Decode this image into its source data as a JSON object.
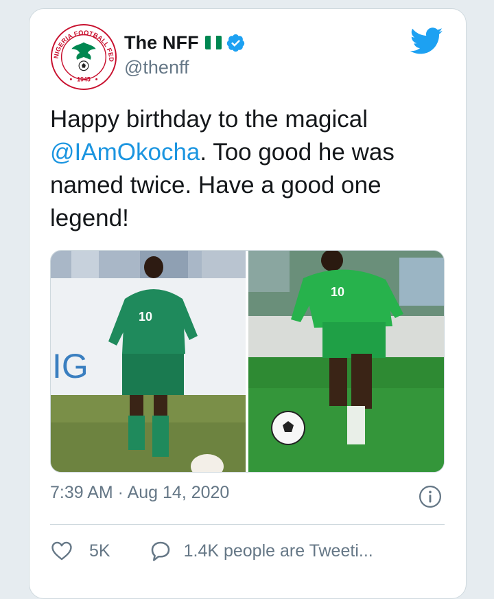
{
  "author": {
    "name": "The NFF",
    "handle": "@thenff",
    "avatar_text_top": "NIGERIA FOOTBALL FEDERATION",
    "avatar_year": "1945"
  },
  "tweet": {
    "text_before": "Happy birthday to the magical ",
    "mention": "@IAmOkocha",
    "text_after": ". Too good he was named twice. Have a good one legend!"
  },
  "media": {
    "left_jersey_number": "10",
    "left_board_text": "IG",
    "right_jersey_number": "10"
  },
  "meta": {
    "time": "7:39 AM",
    "separator": " · ",
    "date": "Aug 14, 2020"
  },
  "engagement": {
    "likes": "5K",
    "tweeting": "1.4K people are Tweeti..."
  },
  "colors": {
    "accent": "#1b95e0",
    "twitter_blue": "#1da1f2",
    "nigeria_green": "#008751",
    "muted": "#657786"
  },
  "icons": [
    "twitter-bird-icon",
    "verified-badge-icon",
    "nigeria-flag-icon",
    "info-icon",
    "heart-icon",
    "reply-bubble-icon"
  ]
}
